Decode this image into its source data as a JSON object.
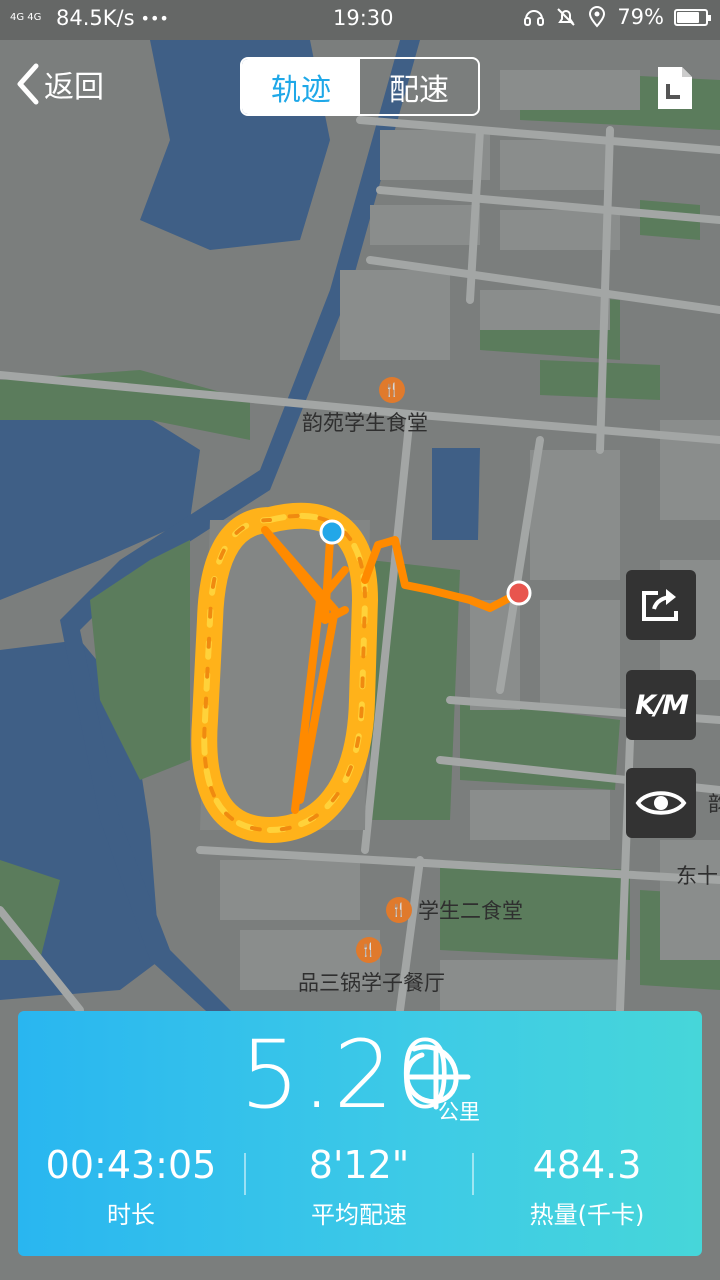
{
  "status_bar": {
    "network": "4G 4G",
    "speed": "84.5K/s",
    "more": "•••",
    "time": "19:30",
    "battery": "79%",
    "battery_level": 0.79
  },
  "header": {
    "back_label": "返回",
    "tabs": [
      {
        "label": "轨迹",
        "active": true
      },
      {
        "label": "配速",
        "active": false
      }
    ]
  },
  "map": {
    "pois": [
      {
        "label": "韵苑学生食堂",
        "icon": "restaurant-icon"
      },
      {
        "label": "学生二食堂",
        "icon": "restaurant-icon"
      },
      {
        "label": "品三锅学子餐厅",
        "icon": "restaurant-icon"
      }
    ],
    "edge_labels": [
      "东十",
      "韵"
    ],
    "route_color": "#ff8a00",
    "start_color": "#22a7e8",
    "end_color": "#e8554e"
  },
  "side_buttons": {
    "share_icon": "share-icon",
    "unit_label": "K/M",
    "eye_icon": "eye-icon"
  },
  "summary": {
    "distance": "5.20",
    "distance_unit": "公里",
    "stats": [
      {
        "value": "00:43:05",
        "label": "时长"
      },
      {
        "value": "8'12\"",
        "label": "平均配速"
      },
      {
        "value": "484.3",
        "label": "热量(千卡)"
      }
    ]
  },
  "colors": {
    "accent": "#1fa8e8",
    "card_start": "#29b6f0",
    "card_end": "#46d6d9"
  }
}
